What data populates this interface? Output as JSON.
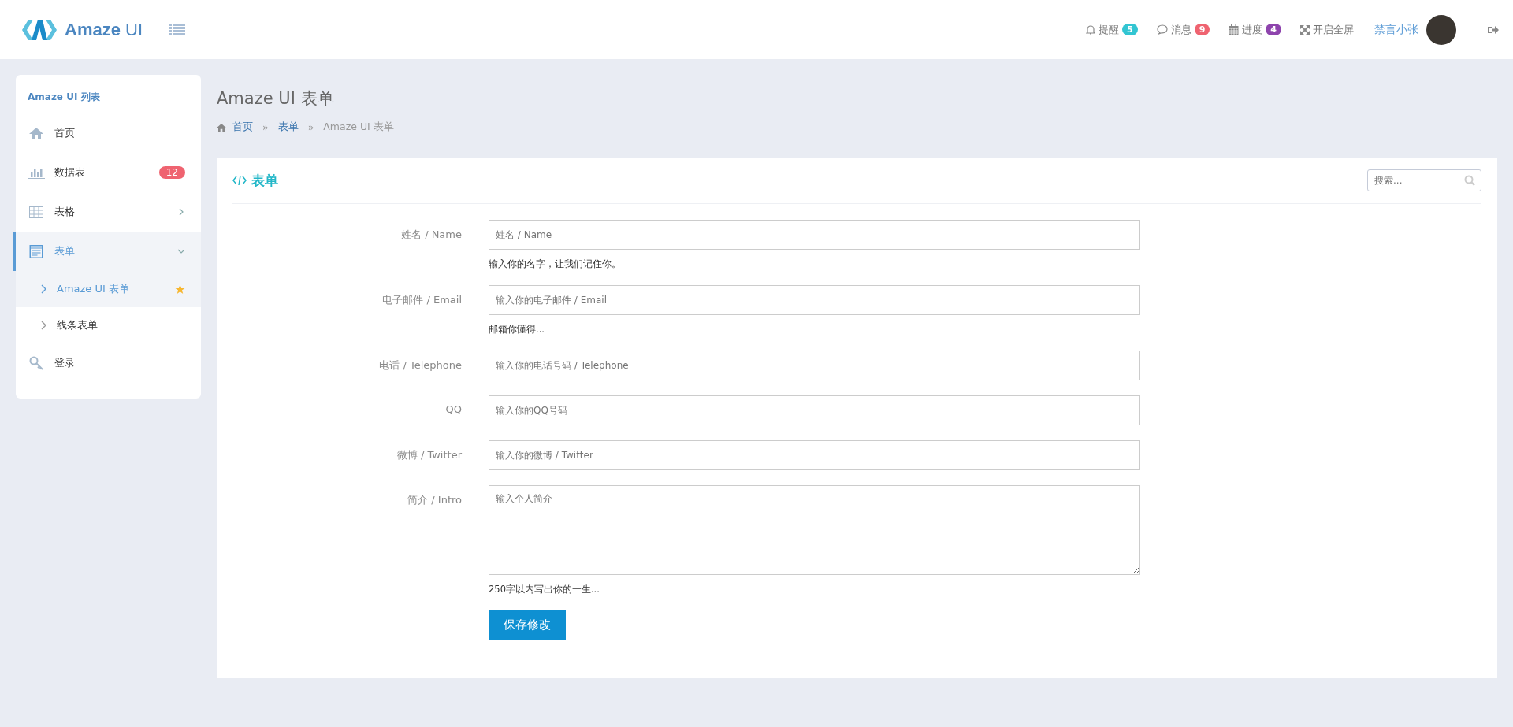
{
  "header": {
    "brand": "Amaze",
    "brand_suffix": "UI",
    "nav": [
      {
        "kind": "bell",
        "label": "提醒",
        "badge": "5",
        "color": "#32c5d2"
      },
      {
        "kind": "chat",
        "label": "消息",
        "badge": "9",
        "color": "#ef6370"
      },
      {
        "kind": "calendar",
        "label": "进度",
        "badge": "4",
        "color": "#8e44ad"
      },
      {
        "kind": "expand",
        "label": "开启全屏"
      }
    ],
    "user": "禁言小张"
  },
  "sidebar": {
    "title": "Amaze UI 列表",
    "items": [
      {
        "kind": "home",
        "label": "首页",
        "selected": false
      },
      {
        "kind": "chart",
        "label": "数据表",
        "badge": "12",
        "selected": false
      },
      {
        "kind": "table",
        "label": "表格",
        "expanded": false,
        "selected": false
      },
      {
        "kind": "form",
        "label": "表单",
        "expanded": true,
        "selected": true,
        "children": [
          {
            "label": "Amaze UI 表单",
            "selected": true,
            "starred": true
          },
          {
            "label": "线条表单",
            "selected": false,
            "starred": false
          }
        ]
      },
      {
        "kind": "key",
        "label": "登录",
        "selected": false
      }
    ]
  },
  "page": {
    "title": "Amaze UI 表单",
    "separator": "»",
    "breadcrumb": [
      {
        "label": "首页",
        "link": true
      },
      {
        "label": "表单",
        "link": true
      },
      {
        "label": "Amaze UI 表单",
        "link": false
      }
    ]
  },
  "panel": {
    "title": "表单",
    "search": {
      "placeholder": "搜索..."
    },
    "fields": [
      {
        "kind": "input",
        "label": "姓名 / Name",
        "placeholder": "姓名 / Name",
        "help": "输入你的名字，让我们记住你。"
      },
      {
        "kind": "input",
        "label": "电子邮件 / Email",
        "placeholder": "输入你的电子邮件 / Email",
        "help": "邮箱你懂得..."
      },
      {
        "kind": "input",
        "label": "电话 / Telephone",
        "placeholder": "输入你的电话号码 / Telephone"
      },
      {
        "kind": "input",
        "label": "QQ",
        "placeholder": "输入你的QQ号码"
      },
      {
        "kind": "input",
        "label": "微博 / Twitter",
        "placeholder": "输入你的微博 / Twitter"
      },
      {
        "kind": "textarea",
        "label": "简介 / Intro",
        "placeholder": "输入个人简介",
        "help": "250字以内写出你的一生..."
      }
    ],
    "submit": "保存修改"
  }
}
